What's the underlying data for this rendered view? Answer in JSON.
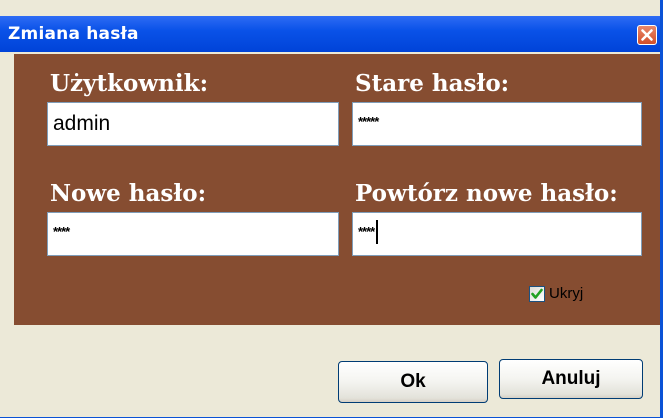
{
  "window": {
    "title": "Zmiana hasła",
    "close_label": "✕"
  },
  "form": {
    "user_label": "Użytkownik:",
    "user_value": "admin",
    "old_password_label": "Stare hasło:",
    "old_password_mask": "*****",
    "new_password_label": "Nowe hasło:",
    "new_password_mask": "****",
    "repeat_password_label": "Powtórz nowe hasło:",
    "repeat_password_mask": "****",
    "hide_label": "Ukryj",
    "hide_checked": true
  },
  "buttons": {
    "ok_label": "Ok",
    "cancel_label": "Anuluj"
  },
  "colors": {
    "titlebar": "#0a52e8",
    "panel": "#864d31",
    "dialog_bg": "#ece9d8",
    "checkmark": "#21a121"
  }
}
